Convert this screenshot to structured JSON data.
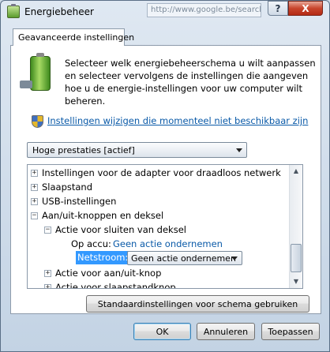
{
  "window": {
    "title": "Energiebeheer",
    "background_url": "http://www.google.be/search",
    "help_label": "?",
    "close_label": "X"
  },
  "tab": {
    "label": "Geavanceerde instellingen"
  },
  "description": "Selecteer welk energiebeheerschema u wilt aanpassen en selecteer vervolgens de instellingen die aangeven hoe u de energie-instellingen voor uw computer wilt beheren.",
  "settings_link": "Instellingen wijzigen die momenteel niet beschikbaar zijn",
  "plan_select": {
    "value": "Hoge prestaties [actief]"
  },
  "tree": {
    "items": [
      {
        "expander": "+",
        "label": "Instellingen voor de adapter voor draadloos netwerk"
      },
      {
        "expander": "+",
        "label": "Slaapstand"
      },
      {
        "expander": "+",
        "label": "USB-instellingen"
      },
      {
        "expander": "−",
        "label": "Aan/uit-knoppen en deksel"
      },
      {
        "expander": "−",
        "label": "Actie voor sluiten van deksel"
      },
      {
        "label": "Op accu:",
        "value": "Geen actie ondernemen"
      },
      {
        "label": "Netstroom:",
        "value": "Geen actie ondernemen"
      },
      {
        "expander": "+",
        "label": "Actie voor aan/uit-knop"
      },
      {
        "expander": "+",
        "label": "Actie voor slaapstandknop"
      }
    ]
  },
  "scrollbar": {
    "up": "▲",
    "down": "▼"
  },
  "buttons": {
    "defaults": "Standaardinstellingen voor schema gebruiken",
    "ok": "OK",
    "cancel": "Annuleren",
    "apply": "Toepassen"
  }
}
